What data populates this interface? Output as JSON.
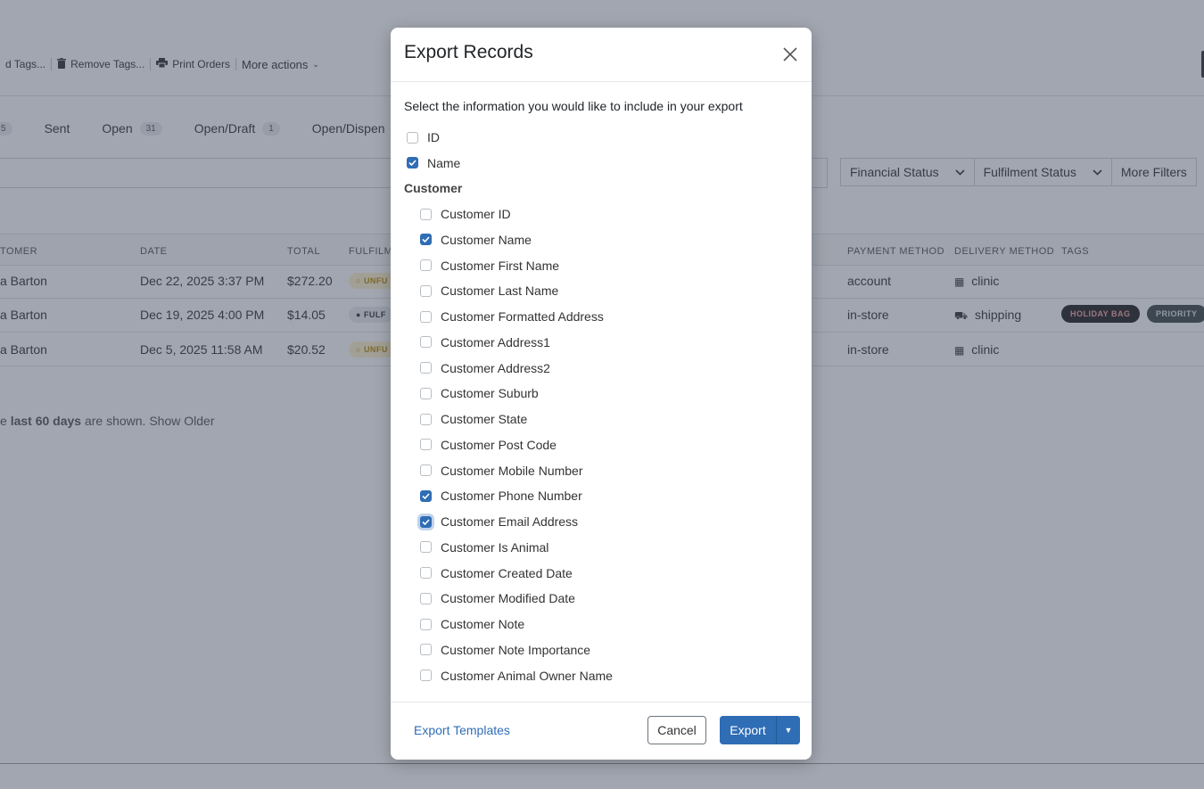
{
  "toolbar": {
    "add_tags": "d Tags...",
    "remove_tags": "Remove Tags...",
    "print_orders": "Print Orders",
    "more_actions": "More actions"
  },
  "tabs": [
    {
      "label": "",
      "count": "5"
    },
    {
      "label": "Sent",
      "count": ""
    },
    {
      "label": "Open",
      "count": "31"
    },
    {
      "label": "Open/Draft",
      "count": "1"
    },
    {
      "label": "Open/Dispen",
      "count": ""
    }
  ],
  "filters": {
    "financial_status": "Financial Status",
    "fulfilment_status": "Fulfilment Status",
    "more_filters": "More Filters"
  },
  "table": {
    "headers": {
      "customer": "TOMER",
      "date": "DATE",
      "total": "TOTAL",
      "fulfilment": "FULFILM",
      "payment": "PAYMENT METHOD",
      "delivery": "DELIVERY METHOD",
      "tags": "TAGS"
    },
    "rows": [
      {
        "customer": "a Barton",
        "date": "Dec 22, 2025 3:37 PM",
        "total": "$272.20",
        "fulfilment": "UNFU",
        "payment": "account",
        "delivery": "clinic",
        "tags": []
      },
      {
        "customer": "a Barton",
        "date": "Dec 19, 2025 4:00 PM",
        "total": "$14.05",
        "fulfilment": "FULF",
        "payment": "in-store",
        "delivery": "shipping",
        "tags": [
          "HOLIDAY BAG",
          "PRIORITY"
        ]
      },
      {
        "customer": "a Barton",
        "date": "Dec 5, 2025 11:58 AM",
        "total": "$20.52",
        "fulfilment": "UNFU",
        "payment": "in-store",
        "delivery": "clinic",
        "tags": []
      }
    ],
    "footer_prefix": "e ",
    "footer_bold": "last 60 days",
    "footer_suffix": " are shown. ",
    "footer_link": "Show Older"
  },
  "modal": {
    "title": "Export Records",
    "intro": "Select the information you would like to include in your export",
    "top_options": [
      {
        "label": "ID",
        "checked": false
      },
      {
        "label": "Name",
        "checked": true
      }
    ],
    "section_label": "Customer",
    "customer_options": [
      {
        "label": "Customer ID",
        "checked": false
      },
      {
        "label": "Customer Name",
        "checked": true
      },
      {
        "label": "Customer First Name",
        "checked": false
      },
      {
        "label": "Customer Last Name",
        "checked": false
      },
      {
        "label": "Customer Formatted Address",
        "checked": false
      },
      {
        "label": "Customer Address1",
        "checked": false
      },
      {
        "label": "Customer Address2",
        "checked": false
      },
      {
        "label": "Customer Suburb",
        "checked": false
      },
      {
        "label": "Customer State",
        "checked": false
      },
      {
        "label": "Customer Post Code",
        "checked": false
      },
      {
        "label": "Customer Mobile Number",
        "checked": false
      },
      {
        "label": "Customer Phone Number",
        "checked": true
      },
      {
        "label": "Customer Email Address",
        "checked": true,
        "focused": true
      },
      {
        "label": "Customer Is Animal",
        "checked": false
      },
      {
        "label": "Customer Created Date",
        "checked": false
      },
      {
        "label": "Customer Modified Date",
        "checked": false
      },
      {
        "label": "Customer Note",
        "checked": false
      },
      {
        "label": "Customer Note Importance",
        "checked": false
      },
      {
        "label": "Customer Animal Owner Name",
        "checked": false
      }
    ],
    "footer": {
      "templates_link": "Export Templates",
      "cancel_label": "Cancel",
      "export_label": "Export"
    }
  },
  "colors": {
    "primary": "#2f6db5",
    "overlay": "rgba(60,70,90,0.48)"
  }
}
